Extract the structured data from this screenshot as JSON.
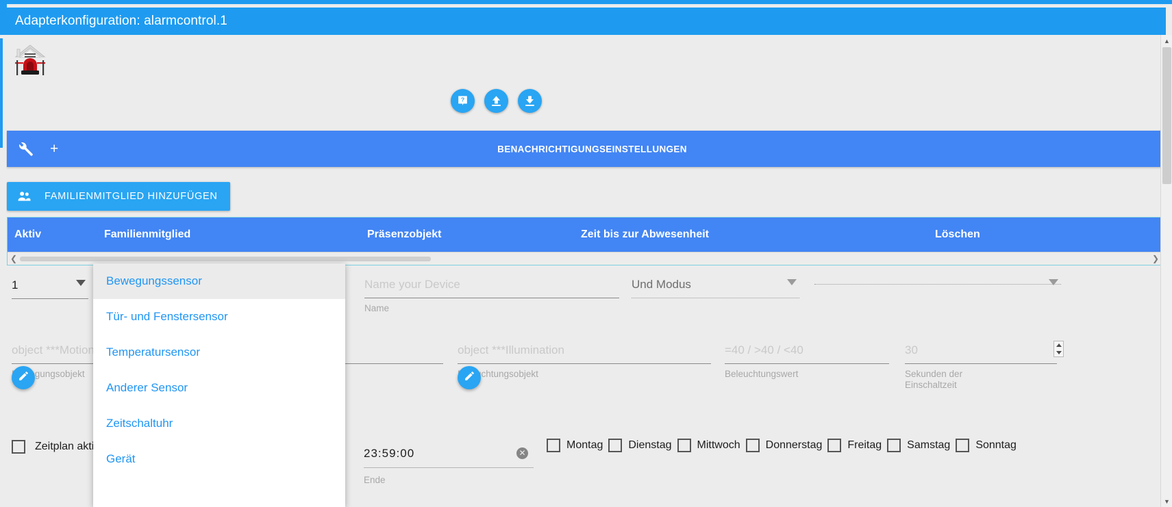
{
  "window": {
    "title": "Adapterkonfiguration: alarmcontrol.1"
  },
  "toolbar": {
    "help_icon": "help-icon",
    "upload_icon": "upload-icon",
    "download_icon": "download-icon"
  },
  "notification_bar": {
    "wrench_icon": "wrench-icon",
    "plus_label": "+",
    "title": "BENACHRICHTIGUNGSEINSTELLUNGEN"
  },
  "actions": {
    "add_family_member": "FAMILIENMITGLIED HINZUFÜGEN",
    "people_icon": "people-icon"
  },
  "table": {
    "columns": [
      {
        "key": "aktiv",
        "label": "Aktiv"
      },
      {
        "key": "familienmitglied",
        "label": "Familienmitglied"
      },
      {
        "key": "praesenzobjekt",
        "label": "Präsenzobjekt"
      },
      {
        "key": "zeit",
        "label": "Zeit bis zur Abwesenheit"
      },
      {
        "key": "loeschen",
        "label": "Löschen"
      }
    ],
    "scroll_left_icon": "chevron-left-icon",
    "scroll_right_icon": "chevron-right-icon"
  },
  "form": {
    "count_select": {
      "value": "1",
      "caret_icon": "chevron-down-icon"
    },
    "device_name": {
      "value": "",
      "placeholder": "Name your Device",
      "hint": "Name"
    },
    "mode_select": {
      "value": "Und Modus",
      "caret_icon": "chevron-down-icon"
    },
    "far_right_select": {
      "value": "",
      "caret_icon": "chevron-down-icon"
    },
    "motion_object": {
      "value": "",
      "placeholder": "object ***Motion",
      "hint": "Bewegungsobjekt",
      "edit_icon": "pencil-icon"
    },
    "illumination_object": {
      "value": "",
      "placeholder": "object ***Illumination",
      "hint": "Beleuchtungsobjekt",
      "edit_icon": "pencil-icon"
    },
    "illumination_value": {
      "value": "",
      "placeholder": "=40 / >40 / <40",
      "hint": "Beleuchtungswert"
    },
    "seconds_on": {
      "value": "",
      "placeholder": "30",
      "hint": "Sekunden der\nEinschaltzeit",
      "spinner_icon": "stepper-icon"
    },
    "schedule_active": {
      "label": "Zeitplan aktiv",
      "checked": false
    },
    "end_time": {
      "value": "23:59:00",
      "hint": "Ende",
      "clear_icon": "clear-circle-icon"
    },
    "weekdays": [
      {
        "label": "Montag",
        "checked": false
      },
      {
        "label": "Dienstag",
        "checked": false
      },
      {
        "label": "Mittwoch",
        "checked": false
      },
      {
        "label": "Donnerstag",
        "checked": false
      },
      {
        "label": "Freitag",
        "checked": false
      },
      {
        "label": "Samstag",
        "checked": false
      },
      {
        "label": "Sonntag",
        "checked": false
      }
    ]
  },
  "dropdown": {
    "open": true,
    "items": [
      {
        "label": "Bewegungssensor",
        "highlighted": true
      },
      {
        "label": "Tür- und Fenstersensor",
        "highlighted": false
      },
      {
        "label": "Temperatursensor",
        "highlighted": false
      },
      {
        "label": "Anderer Sensor",
        "highlighted": false
      },
      {
        "label": "Zeitschaltuhr",
        "highlighted": false
      },
      {
        "label": "Gerät",
        "highlighted": false
      }
    ]
  },
  "scrollbar": {
    "up_icon": "chevron-up-icon",
    "down_icon": "chevron-down-icon"
  },
  "colors": {
    "accent": "#1e9bf0",
    "bar": "#4285f4",
    "button": "#29a5f3",
    "link": "#2196f3",
    "background": "#ececec"
  }
}
